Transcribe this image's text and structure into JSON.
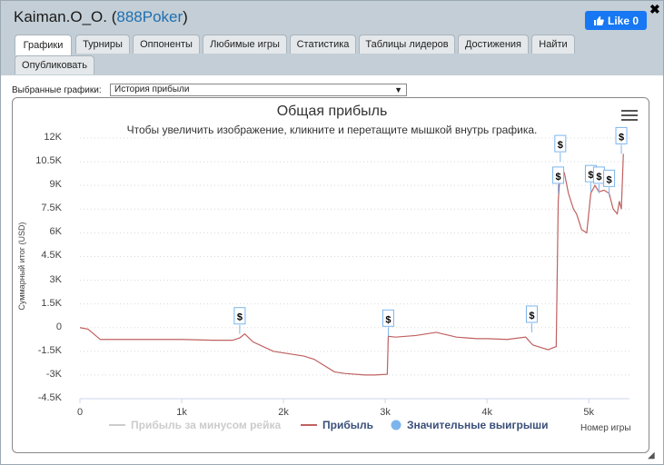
{
  "header": {
    "player_name": "Kaiman.O_O.",
    "site_open": " (",
    "site": "888Poker",
    "site_close": ")",
    "like_label": "Like 0",
    "close_glyph": "✖"
  },
  "tabs": [
    {
      "label": "Графики",
      "active": true
    },
    {
      "label": "Турниры"
    },
    {
      "label": "Оппоненты"
    },
    {
      "label": "Любимые игры"
    },
    {
      "label": "Статистика"
    },
    {
      "label": "Таблицы лидеров"
    },
    {
      "label": "Достижения"
    },
    {
      "label": "Найти"
    },
    {
      "label": "Опубликовать"
    }
  ],
  "selector": {
    "label": "Выбранные графики:",
    "value": "История прибыли"
  },
  "chart_data": {
    "type": "line",
    "title": "Общая прибыль",
    "subtitle": "Чтобы увеличить изображение, кликните и перетащите мышкой внутрь графика.",
    "ylabel": "Суммарный итог (USD)",
    "xlabel": "Номер игры",
    "ylim": [
      -4500,
      12000
    ],
    "xlim": [
      0,
      5400
    ],
    "y_ticks": [
      "12K",
      "10.5K",
      "9K",
      "7.5K",
      "6K",
      "4.5K",
      "3K",
      "1.5K",
      "0",
      "-1.5K",
      "-3K",
      "-4.5K"
    ],
    "x_ticks": [
      "0",
      "1k",
      "2k",
      "3k",
      "4k",
      "5k"
    ],
    "series": [
      {
        "name": "Прибыль за минусом рейка",
        "color": "#cccccc",
        "values": []
      },
      {
        "name": "Прибыль",
        "color": "#c06060",
        "x": [
          0,
          80,
          200,
          600,
          1000,
          1300,
          1500,
          1570,
          1620,
          1700,
          1900,
          2200,
          2300,
          2500,
          2600,
          2800,
          2900,
          3020,
          3030,
          3100,
          3300,
          3500,
          3700,
          3900,
          4000,
          4200,
          4380,
          4450,
          4500,
          4600,
          4680,
          4700,
          4720,
          4760,
          4800,
          4850,
          4880,
          4930,
          4980,
          5020,
          5060,
          5100,
          5150,
          5200,
          5240,
          5280,
          5300,
          5320,
          5340
        ],
        "y": [
          0,
          -100,
          -750,
          -750,
          -750,
          -800,
          -800,
          -650,
          -400,
          -900,
          -1500,
          -1800,
          -2000,
          -2800,
          -2900,
          -3000,
          -3000,
          -2950,
          -550,
          -600,
          -500,
          -300,
          -600,
          -700,
          -700,
          -750,
          -600,
          -1100,
          -1200,
          -1400,
          -1200,
          8000,
          10000,
          9800,
          8500,
          7500,
          7200,
          6200,
          6000,
          8500,
          9000,
          8600,
          8700,
          8500,
          7500,
          7200,
          8000,
          7500,
          11000
        ]
      },
      {
        "name": "Значительные выигрыши",
        "color": "#7cb5ec",
        "values": []
      }
    ],
    "big_wins": [
      {
        "x": 1570,
        "y": -400,
        "label": "$"
      },
      {
        "x": 3030,
        "y": -550,
        "label": "$"
      },
      {
        "x": 4440,
        "y": -300,
        "label": "$"
      },
      {
        "x": 4700,
        "y": 8500,
        "label": "$"
      },
      {
        "x": 4720,
        "y": 10500,
        "label": "$"
      },
      {
        "x": 5020,
        "y": 8600,
        "label": "$"
      },
      {
        "x": 5100,
        "y": 8500,
        "label": "$"
      },
      {
        "x": 5200,
        "y": 8300,
        "label": "$"
      },
      {
        "x": 5320,
        "y": 11000,
        "label": "$"
      }
    ]
  }
}
